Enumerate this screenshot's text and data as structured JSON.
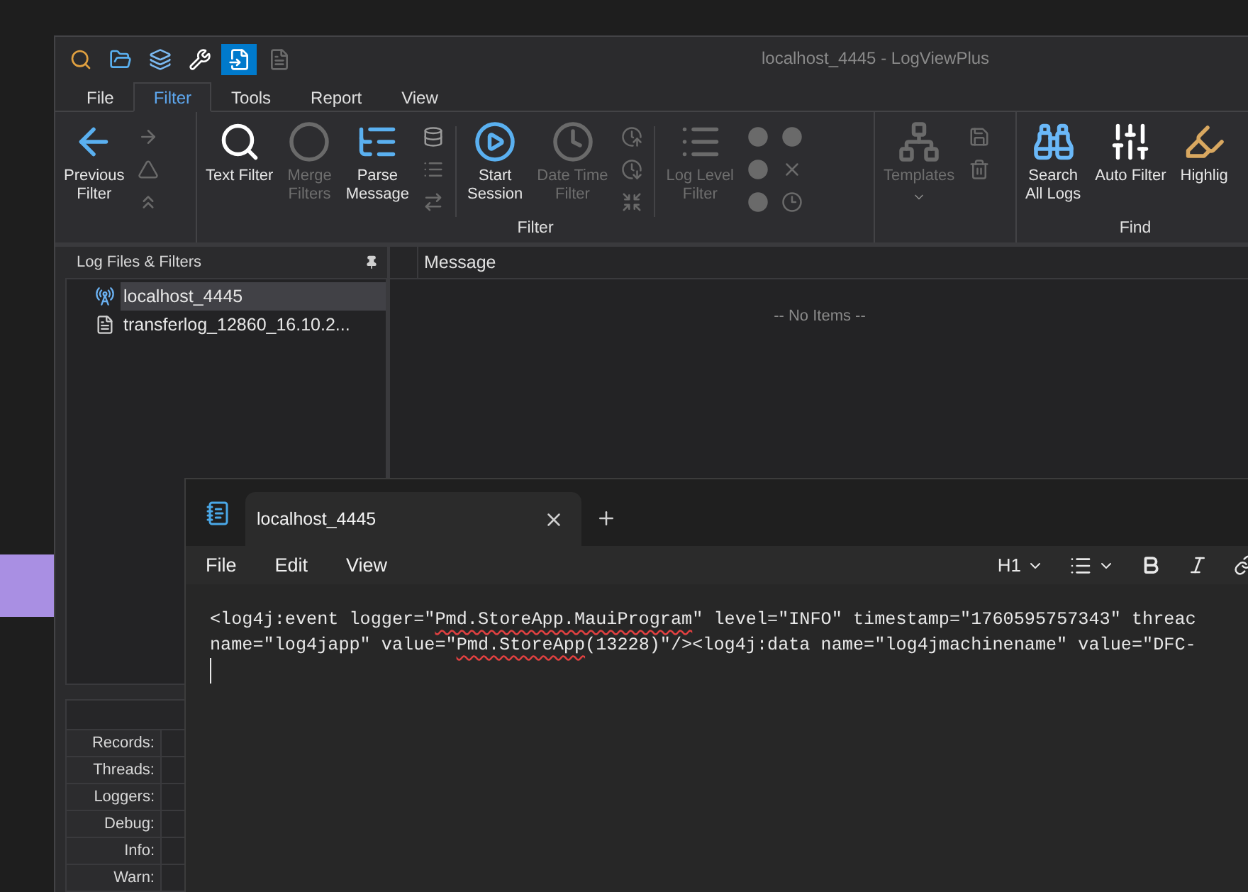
{
  "desktop": {
    "tile": {
      "color": "#a98fe3"
    }
  },
  "app_window": {
    "title": "localhost_4445 - LogViewPlus",
    "quick_access": [
      {
        "selected": false
      },
      {
        "selected": false
      },
      {
        "selected": false
      },
      {
        "selected": false
      },
      {
        "selected": true
      },
      {
        "selected": false
      }
    ],
    "menu_tabs": [
      {
        "label": "File",
        "selected": false
      },
      {
        "label": "Filter",
        "selected": true
      },
      {
        "label": "Tools",
        "selected": false
      },
      {
        "label": "Report",
        "selected": false
      },
      {
        "label": "View",
        "selected": false
      }
    ],
    "ribbon": {
      "groups": [
        {
          "items": [
            {
              "kind": "large",
              "label": "Previous\nFilter",
              "disabled": false
            },
            {
              "kind": "icons",
              "icons": [
                {
                  "disabled": true
                },
                {
                  "disabled": true
                },
                {
                  "disabled": true
                }
              ]
            }
          ]
        },
        {
          "label": "Filter",
          "items": [
            {
              "kind": "large",
              "label": "Text Filter",
              "disabled": false
            },
            {
              "kind": "large",
              "label": "Merge\nFilters",
              "disabled": true
            },
            {
              "kind": "large",
              "label": "Parse\nMessage",
              "disabled": false
            },
            {
              "kind": "icons",
              "icons": [
                {
                  "disabled": false
                },
                {
                  "disabled": true
                },
                {
                  "disabled": true
                }
              ]
            },
            {
              "kind": "separator"
            },
            {
              "kind": "large",
              "label": "Start\nSession",
              "disabled": false
            },
            {
              "kind": "large",
              "label": "Date Time\nFilter",
              "disabled": true
            },
            {
              "kind": "icons",
              "icons": [
                {
                  "disabled": true
                },
                {
                  "disabled": true
                },
                {
                  "disabled": true
                }
              ]
            },
            {
              "kind": "separator"
            },
            {
              "kind": "large",
              "label": "Log Level\nFilter",
              "disabled": true
            },
            {
              "kind": "icons",
              "icons": [
                {
                  "disabled": true
                },
                {
                  "disabled": true
                },
                {
                  "disabled": true
                }
              ]
            },
            {
              "kind": "icons",
              "icons": [
                {
                  "disabled": true
                },
                {
                  "disabled": true
                },
                {
                  "disabled": true
                }
              ]
            }
          ]
        },
        {
          "items": [
            {
              "kind": "large",
              "label": "Templates",
              "disabled": true,
              "dropdown": true
            },
            {
              "kind": "icons",
              "icons": [
                {
                  "disabled": true
                },
                {
                  "disabled": true
                }
              ]
            }
          ]
        },
        {
          "label": "Find",
          "items": [
            {
              "kind": "large",
              "label": "Search\nAll Logs",
              "disabled": false
            },
            {
              "kind": "large",
              "label": "Auto Filter",
              "disabled": false
            },
            {
              "kind": "large",
              "label": "Highlig",
              "disabled": false
            }
          ]
        }
      ]
    },
    "side_panel": {
      "title": "Log Files & Filters",
      "items": [
        {
          "label": "localhost_4445",
          "kind": "live",
          "selected": true
        },
        {
          "label": "transferlog_12860_16.10.2...",
          "kind": "file",
          "selected": false
        }
      ]
    },
    "message_pane": {
      "column": "Message",
      "empty_text": "--  No Items  --"
    },
    "stats": {
      "rows": [
        "Records:",
        "Threads:",
        "Loggers:",
        "Debug:",
        "Info:",
        "Warn:"
      ]
    }
  },
  "notepad": {
    "tabs": [
      {
        "label": "localhost_4445",
        "selected": true
      }
    ],
    "menu": [
      "File",
      "Edit",
      "View"
    ],
    "toolbar": {
      "heading": "H1"
    },
    "lines": [
      [
        {
          "text": "<log4j:event logger=\"",
          "misspelled": false
        },
        {
          "text": "Pmd.StoreApp.MauiProgram",
          "misspelled": true
        },
        {
          "text": "\" level=\"INFO\" timestamp=\"1760595757343\" threac",
          "misspelled": false
        }
      ],
      [
        {
          "text": "name=\"log4japp\" value=\"",
          "misspelled": false
        },
        {
          "text": "Pmd.StoreApp",
          "misspelled": true
        },
        {
          "text": "(13228)\"/><log4j:data name=\"log4jmachinename\" value=\"DFC-",
          "misspelled": false
        }
      ]
    ]
  }
}
